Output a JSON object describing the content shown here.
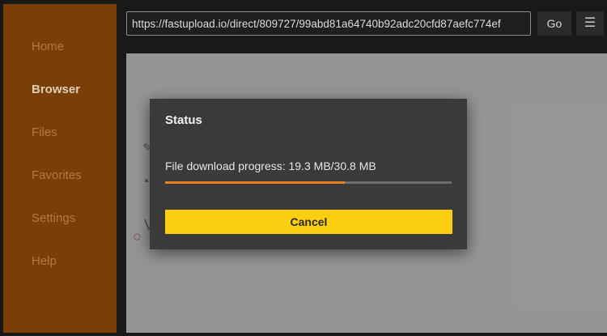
{
  "sidebar": {
    "items": [
      {
        "label": "Home"
      },
      {
        "label": "Browser"
      },
      {
        "label": "Files"
      },
      {
        "label": "Favorites"
      },
      {
        "label": "Settings"
      },
      {
        "label": "Help"
      }
    ],
    "active": "Browser"
  },
  "toolbar": {
    "url": "https://fastupload.io/direct/809727/99abd81a64740b92adc20cfd87aefc774ef",
    "go_label": "Go",
    "menu_icon": "menu-icon"
  },
  "dialog": {
    "title": "Status",
    "progress_text": "File download progress: 19.3 MB/30.8 MB",
    "progress_fraction": 0.627,
    "cancel_label": "Cancel"
  },
  "colors": {
    "sidebar_bg": "#7a3f06",
    "progress": "#e77f1e",
    "cancel_button": "#fcce10"
  }
}
